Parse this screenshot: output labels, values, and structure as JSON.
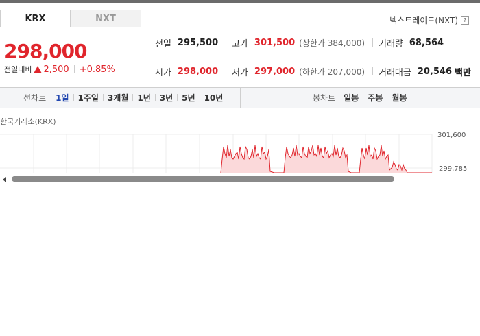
{
  "tabs": [
    {
      "label": "KRX",
      "active": true
    },
    {
      "label": "NXT",
      "active": false
    }
  ],
  "nxt_link": {
    "label": "넥스트레이드(NXT)",
    "help_icon": "question-icon"
  },
  "quote": {
    "price": "298,000",
    "change_label": "전일대비",
    "change_amount": "2,500",
    "change_percent": "+0.85%",
    "up_color": "#e0252c"
  },
  "stats": {
    "prev": {
      "label": "전일",
      "value": "295,500"
    },
    "high": {
      "label": "고가",
      "value": "301,500",
      "sub": "(상한가 384,000)"
    },
    "volume": {
      "label": "거래량",
      "value": "68,564"
    },
    "open": {
      "label": "시가",
      "value": "298,000"
    },
    "low": {
      "label": "저가",
      "value": "297,000",
      "sub": "(하한가 207,000)"
    },
    "amount": {
      "label": "거래대금",
      "value": "20,546",
      "unit": "백만"
    }
  },
  "line_chart_controls": {
    "title": "선차트",
    "periods": [
      {
        "label": "1일",
        "active": true
      },
      {
        "label": "1주일",
        "active": false
      },
      {
        "label": "3개월",
        "active": false
      },
      {
        "label": "1년",
        "active": false
      },
      {
        "label": "3년",
        "active": false
      },
      {
        "label": "5년",
        "active": false
      },
      {
        "label": "10년",
        "active": false
      }
    ]
  },
  "candle_chart_controls": {
    "title": "봉차트",
    "periods": [
      {
        "label": "일봉"
      },
      {
        "label": "주봉"
      },
      {
        "label": "월봉"
      }
    ]
  },
  "chart": {
    "source": "한국거래소(KRX)",
    "y_labels": [
      "301,600",
      "299,785"
    ],
    "line_color": "#e0252c",
    "fill_color": "#fbd9da"
  }
}
